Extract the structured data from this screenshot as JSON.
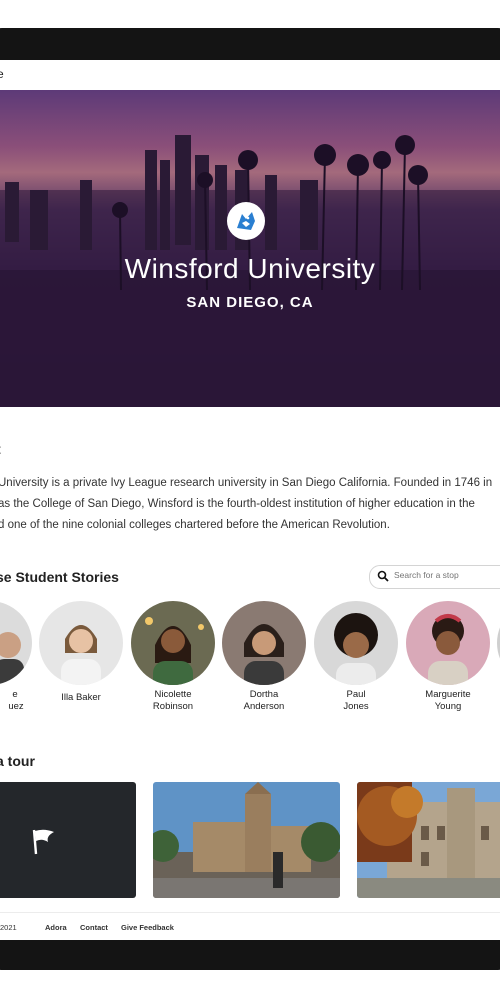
{
  "topbar": {
    "text": "e"
  },
  "hero": {
    "title": "Winsford University",
    "subtitle": "SAN DIEGO, CA"
  },
  "about": {
    "heading": "t",
    "lines": [
      "University is a private Ivy League research university in San Diego California. Founded in 1746 in",
      "as the College of San Diego, Winsford is the fourth-oldest institution of higher education in the",
      "d one of the nine colonial colleges chartered before the American Revolution."
    ]
  },
  "stories": {
    "heading": "se Student Stories",
    "search_placeholder": "Search for a stop",
    "people": [
      {
        "first": "e",
        "last": "uez"
      },
      {
        "first": "Illa Baker",
        "last": ""
      },
      {
        "first": "Nicolette",
        "last": "Robinson"
      },
      {
        "first": "Dortha",
        "last": "Anderson"
      },
      {
        "first": "Paul",
        "last": "Jones"
      },
      {
        "first": "Marguerite",
        "last": "Young"
      }
    ]
  },
  "tour": {
    "heading": "a tour"
  },
  "footer": {
    "copyright": "2021",
    "links": [
      "Adora",
      "Contact",
      "Give Feedback"
    ]
  },
  "colors": {
    "hero_overlay": "#3a1f4d",
    "logo_blue": "#2a7fd1",
    "dark_card": "#24272b"
  },
  "icons": [
    "wolf-logo-icon",
    "search-icon",
    "flag-icon"
  ]
}
